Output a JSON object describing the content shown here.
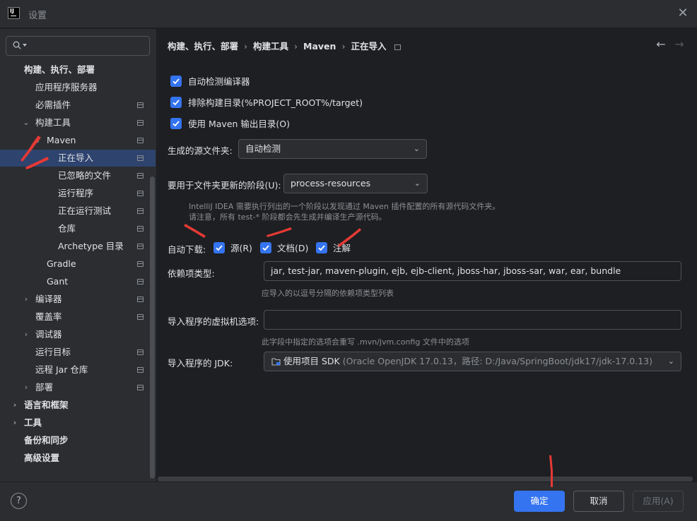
{
  "window": {
    "title": "设置",
    "app_icon_text": "IJ"
  },
  "search": {
    "placeholder": ""
  },
  "sidebar": {
    "items": [
      {
        "label": "构建、执行、部署",
        "bold": true
      },
      {
        "label": "应用程序服务器"
      },
      {
        "label": "必需插件"
      },
      {
        "label": "构建工具"
      },
      {
        "label": "Maven"
      },
      {
        "label": "正在导入"
      },
      {
        "label": "已忽略的文件"
      },
      {
        "label": "运行程序"
      },
      {
        "label": "正在运行测试"
      },
      {
        "label": "仓库"
      },
      {
        "label": "Archetype 目录"
      },
      {
        "label": "Gradle"
      },
      {
        "label": "Gant"
      },
      {
        "label": "编译器"
      },
      {
        "label": "覆盖率"
      },
      {
        "label": "调试器"
      },
      {
        "label": "运行目标"
      },
      {
        "label": "远程 Jar 仓库"
      },
      {
        "label": "部署"
      },
      {
        "label": "语言和框架",
        "bold": true
      },
      {
        "label": "工具",
        "bold": true
      },
      {
        "label": "备份和同步",
        "bold": true
      },
      {
        "label": "高级设置",
        "bold": true
      }
    ]
  },
  "breadcrumb": {
    "items": [
      "构建、执行、部署",
      "构建工具",
      "Maven",
      "正在导入"
    ],
    "separator": "›"
  },
  "nav": {
    "back": "←",
    "forward": "→"
  },
  "main": {
    "checkboxes": [
      {
        "label": "自动检测编译器",
        "checked": true
      },
      {
        "label": "排除构建目录(%PROJECT_ROOT%/target)",
        "checked": true
      },
      {
        "label": "使用 Maven 输出目录(O)",
        "checked": true
      }
    ],
    "generated_sources": {
      "label": "生成的源文件夹:",
      "value": "自动检测"
    },
    "phase": {
      "label": "要用于文件夹更新的阶段(U):",
      "value": "process-resources",
      "hint_line1": "IntelliJ IDEA 需要执行列出的一个阶段以发现通过 Maven 插件配置的所有源代码文件夹。",
      "hint_line2": "请注意，所有 test-* 阶段都会先生成并编译生产源代码。"
    },
    "auto_download": {
      "label": "自动下载:",
      "sources": {
        "label": "源(R)",
        "checked": true
      },
      "docs": {
        "label": "文档(D)",
        "checked": true
      },
      "annotations": {
        "label": "注解",
        "checked": true
      }
    },
    "dependency_types": {
      "label": "依赖项类型:",
      "value": "jar, test-jar, maven-plugin, ejb, ejb-client, jboss-har, jboss-sar, war, ear, bundle",
      "hint": "应导入的以逗号分隔的依赖项类型列表"
    },
    "vm_options": {
      "label": "导入程序的虚拟机选项:",
      "value": "",
      "hint": "此字段中指定的选项会重写 .mvn/jvm.config 文件中的选项"
    },
    "jdk": {
      "label": "导入程序的 JDK:",
      "value": "使用项目 SDK",
      "detail": "(Oracle OpenJDK 17.0.13，路径: D:/Java/SpringBoot/jdk17/jdk-17.0.13)"
    }
  },
  "footer": {
    "help": "?",
    "ok": "确定",
    "cancel": "取消",
    "apply": "应用(A)"
  },
  "colors": {
    "accent": "#3574f0",
    "annotation": "#e53935",
    "selection": "#2e436e"
  }
}
